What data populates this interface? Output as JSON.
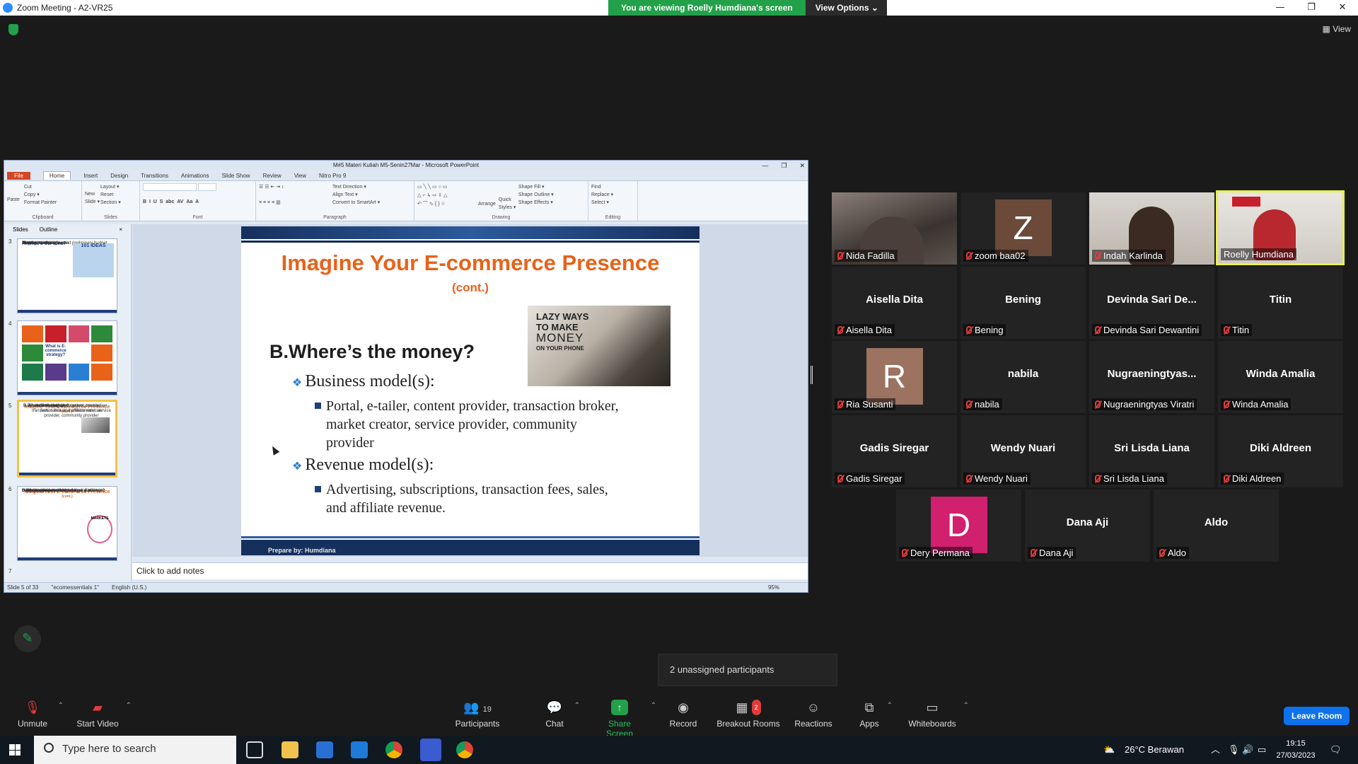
{
  "window": {
    "title": "Zoom Meeting - A2-VR25",
    "min": "—",
    "max": "❐",
    "close": "✕"
  },
  "share_banner": {
    "text": "You are viewing Roelly Humdiana's screen",
    "options": "View Options",
    "options_caret": "⌄"
  },
  "view_button": "View",
  "ppt": {
    "title": "M#5 Materi Kuliah M5-Senin27Mar - Microsoft PowerPoint",
    "win": [
      "—",
      "❐",
      "✕"
    ],
    "tabs": [
      "File",
      "Home",
      "Insert",
      "Design",
      "Transitions",
      "Animations",
      "Slide Show",
      "Review",
      "View",
      "Nitro Pro 9"
    ],
    "ribbon": {
      "clipboard": {
        "paste": "Paste",
        "cut": "Cut",
        "copy": "Copy ▾",
        "format_painter": "Format Painter",
        "label": "Clipboard"
      },
      "slides": {
        "new_slide": "New Slide ▾",
        "layout": "Layout ▾",
        "reset": "Reset",
        "section": "Section ▾",
        "label": "Slides"
      },
      "font": {
        "label": "Font"
      },
      "paragraph": {
        "text_direction": "Text Direction ▾",
        "align_text": "Align Text ▾",
        "convert": "Convert to SmartArt ▾",
        "label": "Paragraph"
      },
      "drawing": {
        "arrange": "Arrange",
        "quick_styles": "Quick Styles ▾",
        "shape_fill": "Shape Fill ▾",
        "shape_outline": "Shape Outline ▾",
        "shape_effects": "Shape Effects ▾",
        "label": "Drawing"
      },
      "editing": {
        "find": "Find",
        "replace": "Replace ▾",
        "select": "Select ▾",
        "label": "Editing"
      }
    },
    "panel_tabs": [
      "Slides",
      "Outline"
    ],
    "panel_close": "×",
    "thumbs": [
      {
        "num": "3",
        "title": "A.What's the idea?",
        "lines": [
          "Vision",
          "Mission statement",
          "Target audience",
          "Intended market space",
          "Strategic analysis",
          "Internet marketing matrix",
          "Development timeline and preliminary budget"
        ],
        "img": "101 IDEAS"
      },
      {
        "num": "4",
        "title": "What is E-commerce strategy?"
      },
      {
        "num": "5",
        "title": "Imagine Your E-commerce Presence",
        "sub": "(cont.)",
        "lines": [
          "B.Where's the money?",
          "Business model(s):",
          "Portal, e-tailer, content provider, transaction broker, market creator, service provider, community provider",
          "Revenue model(s):",
          "Advertising, subscriptions, transaction fees, sales, and affiliate revenue."
        ]
      },
      {
        "num": "6",
        "title": "Imagine Your E-commerce Presence",
        "sub": "(cont.)",
        "lines": [
          "C.Who and where is the target audience?",
          "Describing your audience",
          "Demographics",
          "Age, gender, income, location",
          "Behavior patterns (lifestyle)",
          "Consumption patterns (purchasing habits)",
          "Digital usage patterns",
          "Content creation patterns (blogs, Facebook)",
          "Buyer personas"
        ],
        "img": "MARKETS"
      }
    ],
    "thumb_next": "7",
    "slide": {
      "title": "Imagine Your E-commerce Presence",
      "subtitle": "(cont.)",
      "heading": "B.Where’s the money?",
      "bullets": [
        {
          "label": "Business model(s):",
          "sub": [
            "Portal, e-tailer, content provider, transaction broker,",
            "market creator, service provider, community",
            "provider"
          ]
        },
        {
          "label": "Revenue model(s):",
          "sub": [
            "Advertising, subscriptions, transaction fees, sales,",
            "and affiliate revenue."
          ]
        }
      ],
      "image_caption": [
        "LAZY WAYS",
        "TO MAKE",
        "MONEY",
        "ON YOUR PHONE"
      ],
      "footer": "Prepare by: Humdiana"
    },
    "notes_placeholder": "Click to add notes",
    "status": {
      "slide": "Slide 5 of 33",
      "theme": "\"ecomessentials 1\"",
      "lang": "English (U.S.)",
      "zoom": "95%"
    }
  },
  "participants": [
    {
      "label": "Nida Fadilla",
      "kind": "video"
    },
    {
      "label": "zoom baa02",
      "kind": "avatar",
      "letter": "Z",
      "color": "#6b4a3a"
    },
    {
      "label": "Indah Karlinda",
      "kind": "video"
    },
    {
      "label": "Roelly Humdiana",
      "kind": "video",
      "active": true
    },
    {
      "label": "Aisella Dita",
      "name": "Aisella Dita"
    },
    {
      "label": "Bening",
      "name": "Bening"
    },
    {
      "label": "Devinda Sari Dewantini",
      "name": "Devinda Sari De..."
    },
    {
      "label": "Titin",
      "name": "Titin"
    },
    {
      "label": "Ria Susanti",
      "kind": "avatar",
      "letter": "R",
      "color": "#9b7360"
    },
    {
      "label": "nabila",
      "name": "nabila"
    },
    {
      "label": "Nugraeningtyas Viratri",
      "name": "Nugraeningtyas..."
    },
    {
      "label": "Winda Amalia",
      "name": "Winda Amalia"
    },
    {
      "label": "Gadis Siregar",
      "name": "Gadis Siregar"
    },
    {
      "label": "Wendy Nuari",
      "name": "Wendy Nuari"
    },
    {
      "label": "Sri Lisda Liana",
      "name": "Sri Lisda Liana"
    },
    {
      "label": "Diki Aldreen",
      "name": "Diki Aldreen"
    },
    {
      "label": "Dery Permana",
      "kind": "avatar",
      "letter": "D",
      "color": "#d0206e"
    },
    {
      "label": "Dana Aji",
      "name": "Dana Aji"
    },
    {
      "label": "Aldo",
      "name": "Aldo"
    }
  ],
  "unassigned": "2 unassigned participants",
  "toolbar": {
    "unmute": "Unmute",
    "start_video": "Start Video",
    "participants": "Participants",
    "participant_count": "19",
    "chat": "Chat",
    "share": "Share Screen",
    "record": "Record",
    "breakout": "Breakout Rooms",
    "breakout_badge": "2",
    "reactions": "Reactions",
    "apps": "Apps",
    "whiteboards": "Whiteboards",
    "leave": "Leave Room",
    "caret": "⌃"
  },
  "taskbar": {
    "search_placeholder": "Type here to search",
    "weather": "26°C  Berawan",
    "time": "19:15",
    "date": "27/03/2023"
  }
}
